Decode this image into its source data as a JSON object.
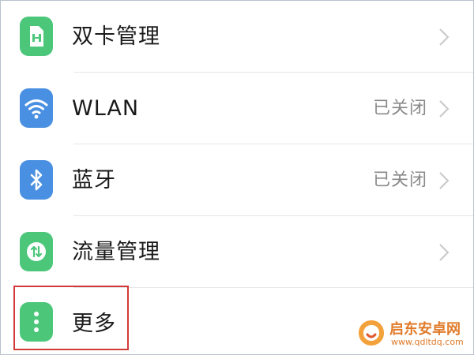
{
  "settings": {
    "items": [
      {
        "label": "双卡管理",
        "status": "",
        "icon": "sim-card-icon",
        "icon_color": "#4cc77a"
      },
      {
        "label": "WLAN",
        "status": "已关闭",
        "icon": "wifi-icon",
        "icon_color": "#4a90e2"
      },
      {
        "label": "蓝牙",
        "status": "已关闭",
        "icon": "bluetooth-icon",
        "icon_color": "#4a90e2"
      },
      {
        "label": "流量管理",
        "status": "",
        "icon": "data-usage-icon",
        "icon_color": "#4cc77a"
      },
      {
        "label": "更多",
        "status": "",
        "icon": "more-dots-icon",
        "icon_color": "#4cc77a"
      }
    ]
  },
  "colors": {
    "highlight": "#d23a3a",
    "chevron": "#c8c8c8",
    "watermark": "#e07b2a"
  },
  "watermark": {
    "title": "启东安卓网",
    "url": "www.qdltdq.com"
  }
}
